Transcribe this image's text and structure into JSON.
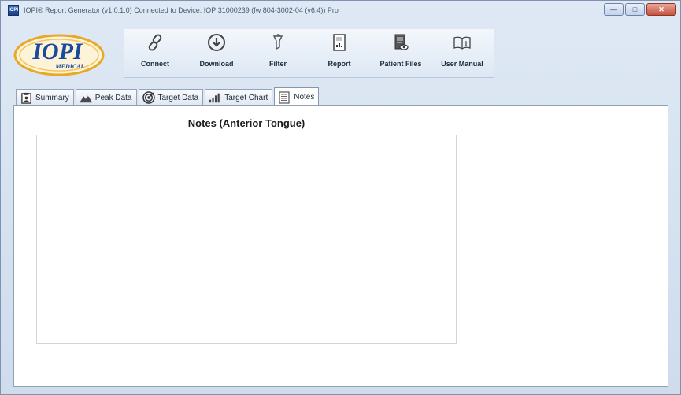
{
  "window": {
    "title": "IOPI® Report Generator  (v1.0.1.0)   Connected to Device: IOPI31000239 (fw 804-3002-04 (v6.4))   Pro",
    "app_icon_text": "IOPI",
    "controls": {
      "minimize": "—",
      "maximize": "□",
      "close": "✕"
    }
  },
  "logo": {
    "brand": "IOPI",
    "sub": "MEDICAL",
    "colors": {
      "blue": "#1a4a9c",
      "gold": "#e8a92a"
    }
  },
  "toolbar": {
    "items": [
      {
        "label": "Connect",
        "icon": "link-icon"
      },
      {
        "label": "Download",
        "icon": "download-icon"
      },
      {
        "label": "Filter",
        "icon": "filter-icon"
      },
      {
        "label": "Report",
        "icon": "report-icon"
      },
      {
        "label": "Patient Files",
        "icon": "patient-files-icon"
      },
      {
        "label": "User Manual",
        "icon": "user-manual-icon"
      }
    ]
  },
  "tabs": {
    "items": [
      {
        "label": "Summary",
        "icon": "clipboard-icon"
      },
      {
        "label": "Peak Data",
        "icon": "mountain-icon"
      },
      {
        "label": "Target Data",
        "icon": "target-icon"
      },
      {
        "label": "Target Chart",
        "icon": "bar-chart-icon"
      },
      {
        "label": "Notes",
        "icon": "notes-icon"
      }
    ],
    "active": "Notes"
  },
  "notes": {
    "title": "Notes (Anterior Tongue)",
    "value": ""
  }
}
